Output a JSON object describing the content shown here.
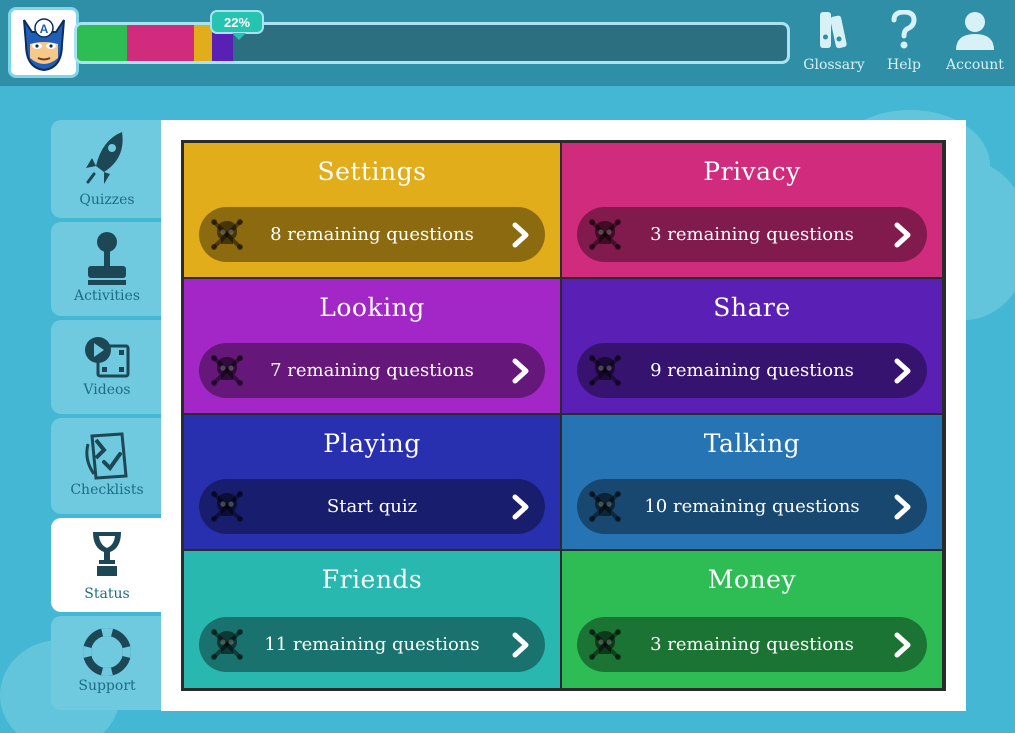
{
  "header": {
    "progress": {
      "label": "22%",
      "segments": [
        {
          "color": "#2ebc55",
          "fraction": 0.07
        },
        {
          "color": "#d02b7c",
          "fraction": 0.095
        },
        {
          "color": "#e2ad1b",
          "fraction": 0.025
        },
        {
          "color": "#5a1fb5",
          "fraction": 0.03
        }
      ],
      "track_color": "#2c6f80"
    },
    "nav": [
      {
        "label": "Glossary",
        "icon": "books-icon"
      },
      {
        "label": "Help",
        "icon": "question-mark-icon"
      },
      {
        "label": "Account",
        "icon": "user-icon"
      }
    ]
  },
  "sidebar": {
    "items": [
      {
        "label": "Quizzes",
        "icon": "rocket-icon",
        "active": false
      },
      {
        "label": "Activities",
        "icon": "joystick-icon",
        "active": false
      },
      {
        "label": "Videos",
        "icon": "film-play-icon",
        "active": false
      },
      {
        "label": "Checklists",
        "icon": "checklist-icon",
        "active": false
      },
      {
        "label": "Status",
        "icon": "trophy-icon",
        "active": true
      },
      {
        "label": "Support",
        "icon": "lifebuoy-icon",
        "active": false
      }
    ]
  },
  "quizzes": [
    {
      "title": "Settings",
      "status": "8 remaining questions",
      "color": "#e2ad1b"
    },
    {
      "title": "Privacy",
      "status": "3 remaining questions",
      "color": "#d02b7c"
    },
    {
      "title": "Looking",
      "status": "7 remaining questions",
      "color": "#a326c6"
    },
    {
      "title": "Share",
      "status": "9 remaining questions",
      "color": "#5a1fb5"
    },
    {
      "title": "Playing",
      "status": "Start quiz",
      "color": "#2930b0"
    },
    {
      "title": "Talking",
      "status": "10 remaining questions",
      "color": "#2774b4"
    },
    {
      "title": "Friends",
      "status": "11 remaining questions",
      "color": "#29b8b0"
    },
    {
      "title": "Money",
      "status": "3 remaining questions",
      "color": "#2ebc55"
    }
  ]
}
